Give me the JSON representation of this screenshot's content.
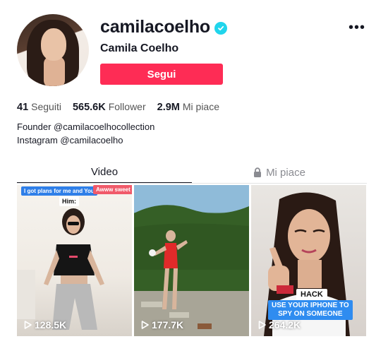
{
  "profile": {
    "username": "camilacoelho",
    "display_name": "Camila Coelho",
    "follow_label": "Segui",
    "more_label": "•••"
  },
  "stats": [
    {
      "value": "41",
      "label": "Seguiti"
    },
    {
      "value": "565.6K",
      "label": "Follower"
    },
    {
      "value": "2.9M",
      "label": "Mi piace"
    }
  ],
  "bio": {
    "line1": "Founder @camilacoelhocollection",
    "line2": "Instagram @camilacoelho"
  },
  "tabs": [
    {
      "label": "Video"
    },
    {
      "label": "Mi piace"
    }
  ],
  "videos": [
    {
      "views": "128.5K",
      "captions": [
        "I got plans for me and You",
        "Awww sweet",
        "Him:"
      ]
    },
    {
      "views": "177.7K"
    },
    {
      "views": "264.2K",
      "captions": [
        "HACK",
        "USE YOUR IPHONE TO",
        "SPY ON SOMEONE"
      ]
    }
  ],
  "colors": {
    "accent": "#fe2c55",
    "verified": "#20d5ec",
    "text": "#161823"
  }
}
